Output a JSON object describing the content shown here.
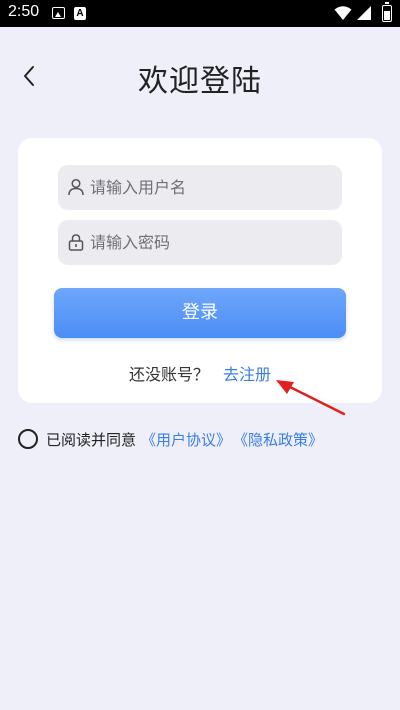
{
  "status_bar": {
    "time": "2:50",
    "icons": [
      "image-icon",
      "a-icon",
      "wifi-icon",
      "signal-icon",
      "battery-icon"
    ]
  },
  "header": {
    "title": "欢迎登陆",
    "back_icon": "chevron-left-icon"
  },
  "form": {
    "username": {
      "placeholder": "请输入用户名",
      "value": "",
      "icon": "user-icon"
    },
    "password": {
      "placeholder": "请输入密码",
      "value": "",
      "icon": "lock-icon"
    },
    "login_label": "登录",
    "register_prompt": "还没账号？",
    "register_link": "去注册"
  },
  "agreement": {
    "text": "已阅读并同意",
    "terms_link": "《用户协议》",
    "privacy_link": "《隐私政策》",
    "checked": false
  },
  "colors": {
    "background": "#eeeff8",
    "primary": "#4b8ef6",
    "link": "#3a7de6",
    "annotation_arrow": "#e02020"
  }
}
